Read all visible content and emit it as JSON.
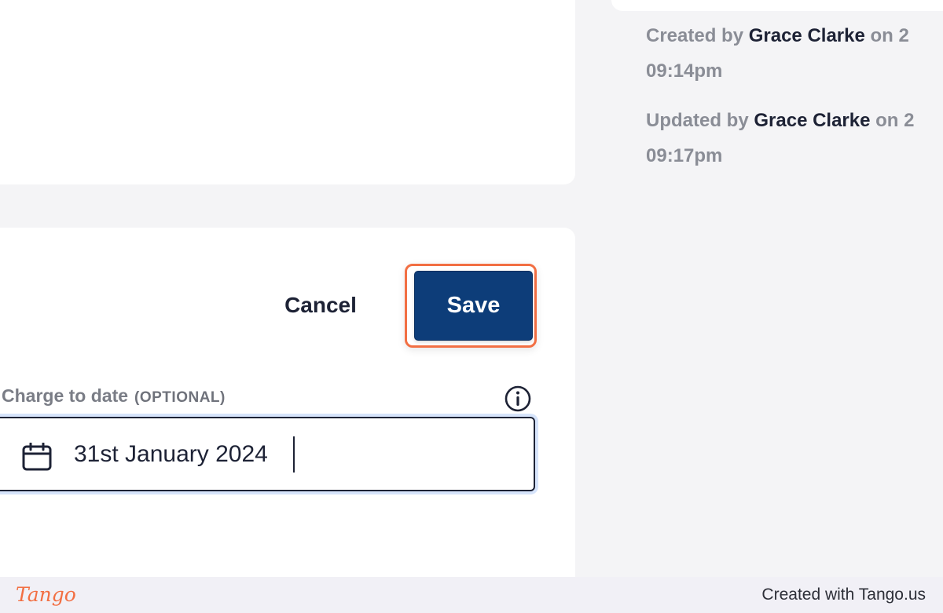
{
  "activity": {
    "created": {
      "prefix": "Created by",
      "user": "Grace Clarke",
      "on": "on 2",
      "time": "09:14pm"
    },
    "updated": {
      "prefix": "Updated by",
      "user": "Grace Clarke",
      "on": "on 2",
      "time": "09:17pm"
    }
  },
  "actions": {
    "cancel_label": "Cancel",
    "save_label": "Save"
  },
  "charge_to_date": {
    "label": "Charge to date",
    "optional_tag": "(OPTIONAL)",
    "value": "31st January 2024"
  },
  "footer": {
    "logo": "Tango",
    "credit": "Created with Tango.us"
  },
  "colors": {
    "primary": "#0d3d79",
    "highlight": "#f26f43",
    "focus_ring": "#d6e4fb",
    "background": "#f4f4f6"
  },
  "icons": {
    "info": "info-circle-icon",
    "calendar": "calendar-icon"
  }
}
